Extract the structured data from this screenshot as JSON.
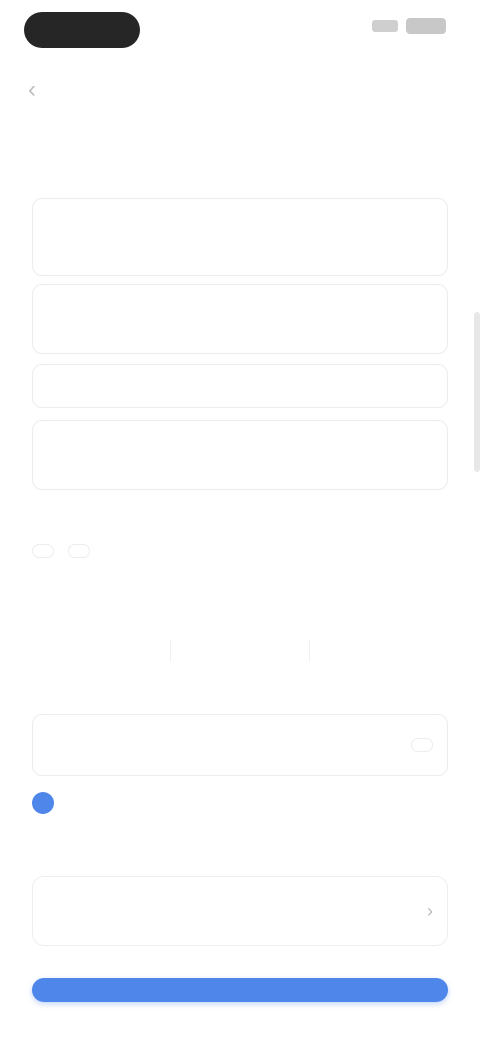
{
  "status": {
    "time": "",
    "icons": [
      "signal-icon",
      "battery-icon"
    ]
  },
  "topnav": {
    "title": ""
  },
  "section": {
    "title": "",
    "edit_label": "",
    "description": ""
  },
  "form": {
    "field1": {
      "label": "",
      "value": ""
    },
    "field2": {
      "label": "",
      "value": ""
    },
    "field3": {
      "label": "",
      "value": ""
    },
    "field4": {
      "label": "",
      "value": ""
    }
  },
  "row1": {
    "title": "",
    "options": [
      "",
      ""
    ]
  },
  "row2": {
    "title": "",
    "cells": [
      {
        "label": "",
        "value": ""
      },
      {
        "label": "",
        "value": ""
      },
      {
        "label": "",
        "value": ""
      }
    ]
  },
  "row3": {
    "left_label": "",
    "left_value": "",
    "right_action": ""
  },
  "consent": {
    "text": ""
  },
  "notice": {
    "text": ""
  },
  "cta": {
    "label": ""
  },
  "colors": {
    "accent": "#4f86ea",
    "background": "#ffffff"
  }
}
